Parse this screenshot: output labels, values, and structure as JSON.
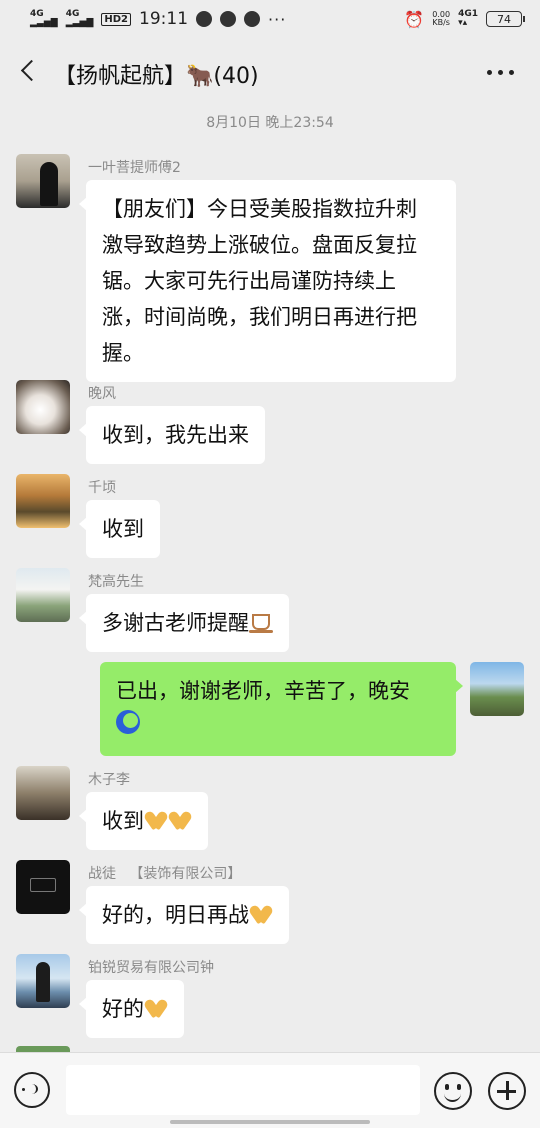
{
  "status_bar": {
    "signal1": "4G",
    "signal2": "4G",
    "hd": "HD2",
    "time": "19:11",
    "dots": "···",
    "net_speed_value": "0.00",
    "net_speed_unit": "KB/s",
    "net_type": "4G1",
    "battery": "74"
  },
  "header": {
    "title": "【扬帆起航】🐂(40)"
  },
  "time_divider": "8月10日 晚上23:54",
  "messages": [
    {
      "sender": "一叶菩提师傅2",
      "text": "【朋友们】今日受美股指数拉升刺激导致趋势上涨破位。盘面反复拉锯。大家可先行出局谨防持续上涨，时间尚晚，我们明日再进行把握。",
      "lines": [
        "【朋友们】今日受美股指数拉升刺",
        "激导致趋势上涨破位。盘面反复拉",
        "锯。大家可先行出局谨防持续上",
        "涨，时间尚晚，我们明日再进行把",
        "握。"
      ]
    },
    {
      "sender": "晚风",
      "text": "收到，我先出来"
    },
    {
      "sender": "千顷",
      "text": "收到"
    },
    {
      "sender": "梵高先生",
      "text": "多谢古老师提醒",
      "emoji": "coffee"
    },
    {
      "sender": "",
      "self": true,
      "text": "已出，谢谢老师，辛苦了，晚安",
      "emoji": "moon"
    },
    {
      "sender": "木子李",
      "text": "收到",
      "emoji": "pray-pray"
    },
    {
      "sender": "战徒",
      "sender_extra": "【装饰有限公司】",
      "text": "好的，明日再战",
      "emoji": "pray"
    },
    {
      "sender": "铂锐贸易有限公司钟",
      "text": "好的",
      "emoji": "pray"
    }
  ],
  "input_bar": {
    "placeholder": ""
  },
  "colors": {
    "background": "#ededed",
    "self_bubble": "#95ec69",
    "other_bubble": "#ffffff"
  }
}
